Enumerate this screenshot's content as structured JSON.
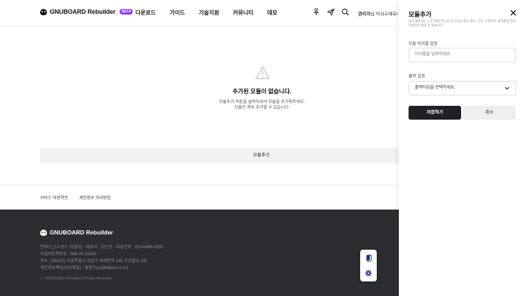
{
  "header": {
    "logo_text": "GNUBOARD Rebuilder",
    "badge": "BETA",
    "nav": [
      "다운로드",
      "가이드",
      "기술지원",
      "커뮤니티",
      "데모"
    ],
    "icons": [
      "pin-icon",
      "send-icon",
      "search-icon"
    ],
    "user_name": "관리자",
    "welcome_suffix": "님 어서오세요!"
  },
  "main": {
    "empty_title": "추가된 모듈이 없습니다.",
    "empty_desc_line1": "모듈추가 버튼을 클릭하셔서 모듈을 추가해주세요.",
    "empty_desc_line2": "모듈은 계속 추가할 수 있습니다.",
    "add_module_label": "모듈추가"
  },
  "footer": {
    "links": [
      "서비스 이용약관",
      "개인정보 처리방침"
    ],
    "logo_text": "GNUBOARD Rebuilder",
    "info": [
      "안에스(그누보드 리빌더) · 대표자 : 김은정 · 대표전화 : 010-6466-3355",
      "사업자등록번호 : 564-06-01859",
      "주소 : (06132) 서울특별시 강남구 테헤란로 145 우신빌딩 15F",
      "개인정보책임자(이메일) : 홍명기(cs@false9.co.kr)"
    ],
    "copyright": "ⓒ GNUBOARD Rebuilder All Rights Reserved."
  },
  "panel": {
    "title": "모듈추가",
    "subtitle": "공식 배포되는 스킨 외에 커스텀 한 스킨의 경우 경우, 간격, 스와이프, 출력항목 등이 적용되지 않을 수 있습니다.",
    "title_label": "모듈 타이틀 설정",
    "title_placeholder": "타이틀을 입력하세요.",
    "output_label": "출력 설정",
    "output_value": "출력타입을 선택하세요.",
    "save_label": "저장하기",
    "cancel_label": "취소"
  },
  "colors": {
    "beta_badge": "#8b3cf7",
    "footer_bg": "#2b2d30",
    "save_button": "#1f2125"
  }
}
